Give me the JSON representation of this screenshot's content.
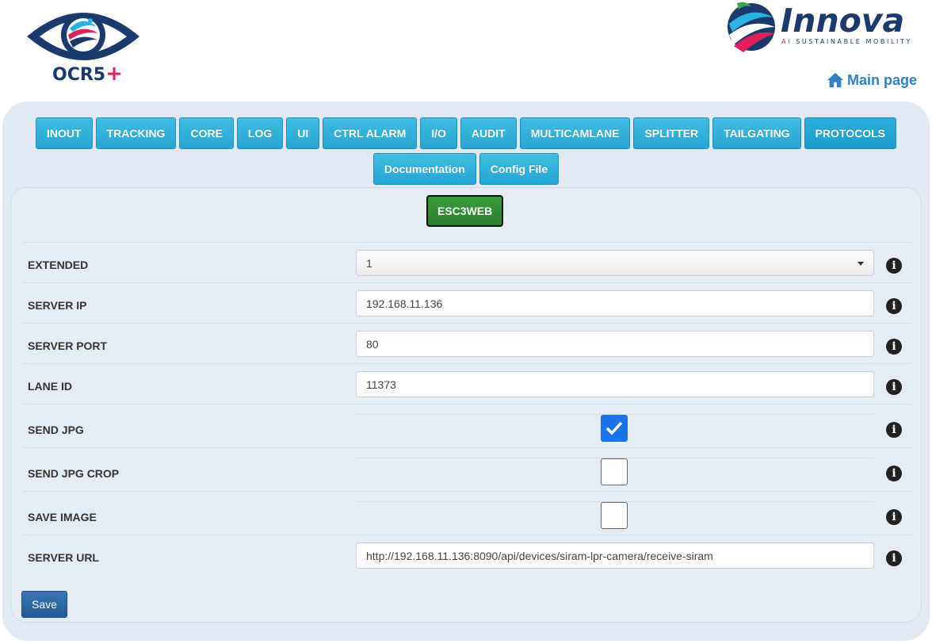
{
  "brand": {
    "ocr_logo_text": "OCR5",
    "ocr_logo_plus": "+",
    "innova_name": "Innova",
    "innova_tagline_ai": "AI",
    "innova_tagline": "SUSTAINABLE MOBILITY"
  },
  "nav": {
    "main_page": "Main page"
  },
  "tabs": [
    "INOUT",
    "TRACKING",
    "CORE",
    "LOG",
    "UI",
    "CTRL ALARM",
    "I/O",
    "AUDIT",
    "MULTICAMLANE",
    "SPLITTER",
    "TAILGATING",
    "PROTOCOLS"
  ],
  "active_tab": "PROTOCOLS",
  "tabs_row2": [
    "Documentation",
    "Config File"
  ],
  "subtab": "ESC3WEB",
  "form": {
    "extended": {
      "label": "EXTENDED",
      "value": "1"
    },
    "server_ip": {
      "label": "SERVER IP",
      "value": "192.168.11.136"
    },
    "server_port": {
      "label": "SERVER PORT",
      "value": "80"
    },
    "lane_id": {
      "label": "LANE ID",
      "value": "11373"
    },
    "send_jpg": {
      "label": "SEND JPG",
      "checked": true
    },
    "send_jpg_crop": {
      "label": "SEND JPG CROP",
      "checked": false
    },
    "save_image": {
      "label": "SAVE IMAGE",
      "checked": false
    },
    "server_url": {
      "label": "SERVER URL",
      "value": "http://192.168.11.136:8090/api/devices/siram-lpr-camera/receive-siram"
    }
  },
  "save_label": "Save",
  "info_glyph": "i",
  "colors": {
    "tab": "#29a9d6",
    "subtab_active": "#2f862f",
    "save": "#2c67a6",
    "checkbox_checked": "#1a73e8",
    "link": "#2f80c8",
    "brand_navy": "#1a3a6e",
    "brand_pink": "#e0205a"
  }
}
